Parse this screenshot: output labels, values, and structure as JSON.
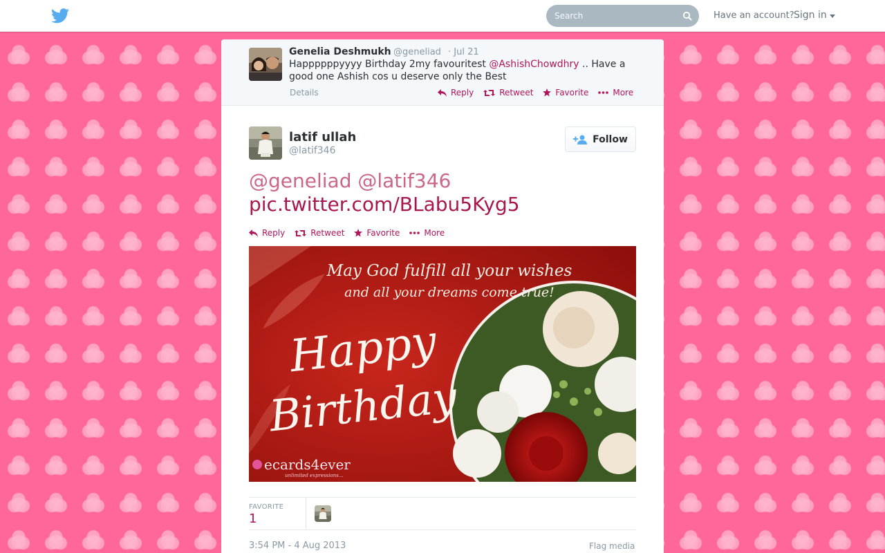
{
  "topbar": {
    "search_placeholder": "Search",
    "account_text": "Have an account?",
    "signin_label": "Sign in"
  },
  "previous_tweet": {
    "name": "Genelia Deshmukh",
    "handle": "@geneliad",
    "date": "· Jul 21",
    "text_before": "Happppppyyyy Birthday 2my favouritest ",
    "mention": "@AshishChowdhry",
    "text_after": " .. Have a good one Ashish cos u deserve only the Best",
    "details_label": "Details",
    "actions": {
      "reply": "Reply",
      "retweet": "Retweet",
      "favorite": "Favorite",
      "more": "More"
    }
  },
  "tweet": {
    "name": "latif ullah",
    "handle": "@latif346",
    "follow_label": "Follow",
    "line1": "@geneliad @latif346",
    "line2": "pic.twitter.com/BLabu5Kyg5",
    "actions": {
      "reply": "Reply",
      "retweet": "Retweet",
      "favorite": "Favorite",
      "more": "More"
    },
    "image": {
      "line1": "May God fulfill all your wishes",
      "line2": "and all your dreams come true!",
      "happy": "Happy",
      "birthday": "Birthday",
      "logo": "ecards4ever",
      "logo_sub": "unlimited expressions..."
    }
  },
  "stats": {
    "favorite_label": "FAVORITE",
    "favorite_count": "1"
  },
  "timestamp": "3:54 PM - 4 Aug 2013",
  "flag_label": "Flag media",
  "colors": {
    "background": "#ff6699",
    "accent": "#b0155a",
    "twitter_blue": "#55acee"
  }
}
